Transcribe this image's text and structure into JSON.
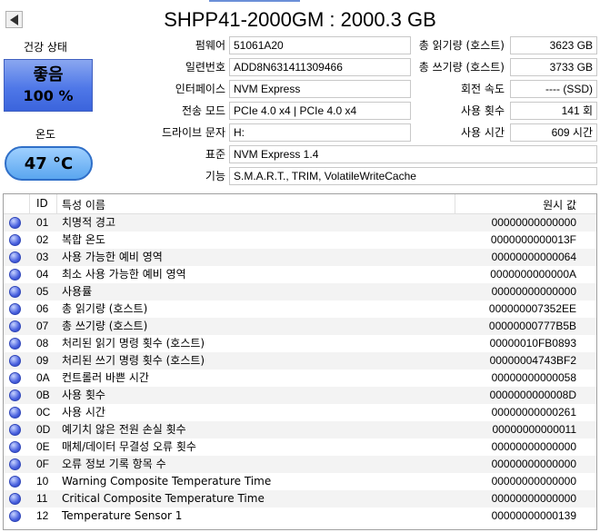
{
  "header": {
    "title": "SHPP41-2000GM : 2000.3 GB"
  },
  "health": {
    "label": "건강 상태",
    "status": "좋음",
    "percent": "100 %",
    "color": "#4f78e8"
  },
  "temperature": {
    "label": "온도",
    "value": "47 °C",
    "color": "#5aa6ef"
  },
  "fields": {
    "firmware": {
      "label": "펌웨어",
      "value": "51061A20"
    },
    "serial": {
      "label": "일련번호",
      "value": "ADD8N631411309466"
    },
    "interface": {
      "label": "인터페이스",
      "value": "NVM Express"
    },
    "transfer": {
      "label": "전송 모드",
      "value": "PCIe 4.0 x4 | PCIe 4.0 x4"
    },
    "drive_letter": {
      "label": "드라이브 문자",
      "value": "H:"
    },
    "standard": {
      "label": "표준",
      "value": "NVM Express 1.4"
    },
    "features": {
      "label": "기능",
      "value": "S.M.A.R.T., TRIM, VolatileWriteCache"
    },
    "host_reads": {
      "label": "총 읽기량 (호스트)",
      "value": "3623 GB"
    },
    "host_writes": {
      "label": "총 쓰기량 (호스트)",
      "value": "3733 GB"
    },
    "rotation": {
      "label": "회전 속도",
      "value": "---- (SSD)"
    },
    "power_count": {
      "label": "사용 횟수",
      "value": "141 회"
    },
    "power_hours": {
      "label": "사용 시간",
      "value": "609 시간"
    }
  },
  "table": {
    "headers": {
      "id": "ID",
      "name": "특성 이름",
      "raw": "원시 값"
    },
    "rows": [
      {
        "id": "01",
        "name": "치명적 경고",
        "raw": "00000000000000"
      },
      {
        "id": "02",
        "name": "복합 온도",
        "raw": "0000000000013F"
      },
      {
        "id": "03",
        "name": "사용 가능한 예비 영역",
        "raw": "00000000000064"
      },
      {
        "id": "04",
        "name": "최소 사용 가능한 예비 영역",
        "raw": "0000000000000A"
      },
      {
        "id": "05",
        "name": "사용률",
        "raw": "00000000000000"
      },
      {
        "id": "06",
        "name": "총 읽기량 (호스트)",
        "raw": "000000007352EE"
      },
      {
        "id": "07",
        "name": "총 쓰기량 (호스트)",
        "raw": "00000000777B5B"
      },
      {
        "id": "08",
        "name": "처리된 읽기 명령 횟수 (호스트)",
        "raw": "00000010FB0893"
      },
      {
        "id": "09",
        "name": "처리된 쓰기 명령 횟수 (호스트)",
        "raw": "00000004743BF2"
      },
      {
        "id": "0A",
        "name": "컨트롤러 바쁜 시간",
        "raw": "00000000000058"
      },
      {
        "id": "0B",
        "name": "사용 횟수",
        "raw": "0000000000008D"
      },
      {
        "id": "0C",
        "name": "사용 시간",
        "raw": "00000000000261"
      },
      {
        "id": "0D",
        "name": "예기치 않은 전원 손실 횟수",
        "raw": "00000000000011"
      },
      {
        "id": "0E",
        "name": "매체/데이터 무결성 오류 횟수",
        "raw": "00000000000000"
      },
      {
        "id": "0F",
        "name": "오류 정보 기록 항목 수",
        "raw": "00000000000000"
      },
      {
        "id": "10",
        "name": "Warning Composite Temperature Time",
        "raw": "00000000000000"
      },
      {
        "id": "11",
        "name": "Critical Composite Temperature Time",
        "raw": "00000000000000"
      },
      {
        "id": "12",
        "name": "Temperature Sensor 1",
        "raw": "00000000000139"
      }
    ]
  },
  "icons": {
    "prev": "triangle-left-icon",
    "status_dot": "status-dot-icon"
  }
}
